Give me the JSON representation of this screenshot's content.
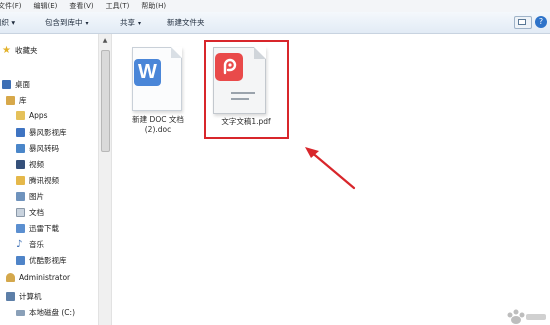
{
  "menu": {
    "file": "文件(F)",
    "edit": "编辑(E)",
    "view": "查看(V)",
    "tools": "工具(T)",
    "help": "帮助(H)"
  },
  "toolbar": {
    "organize": "组织 ▾",
    "include_in_library": "包含到库中",
    "share": "共享",
    "new_folder": "新建文件夹",
    "dropdown_glyph": "▾",
    "help_glyph": "?"
  },
  "sidebar": {
    "favorites": "收藏夹",
    "desktop": "桌面",
    "library": "库",
    "apps": "Apps",
    "baofeng_video_library": "暴风影视库",
    "baofeng_transcode": "暴风转码",
    "videos": "视频",
    "tencent_video": "腾讯视频",
    "pictures": "图片",
    "documents": "文档",
    "xunlei_download": "迅雷下载",
    "music": "音乐",
    "youku_video_library": "优酷影视库",
    "administrator": "Administrator",
    "computer": "计算机",
    "local_disk_c": "本地磁盘 (C:)"
  },
  "files": [
    {
      "label_line1": "新建 DOC 文档",
      "label_line2": "(2).doc",
      "icon": "wps-writer-icon",
      "glyph": "W"
    },
    {
      "label_line1": "文字文稿1.pdf",
      "icon": "wps-pdf-icon"
    }
  ],
  "colors": {
    "doc_accent": "#4a86d8",
    "pdf_accent": "#e94a4a",
    "highlight": "#d8262b"
  }
}
